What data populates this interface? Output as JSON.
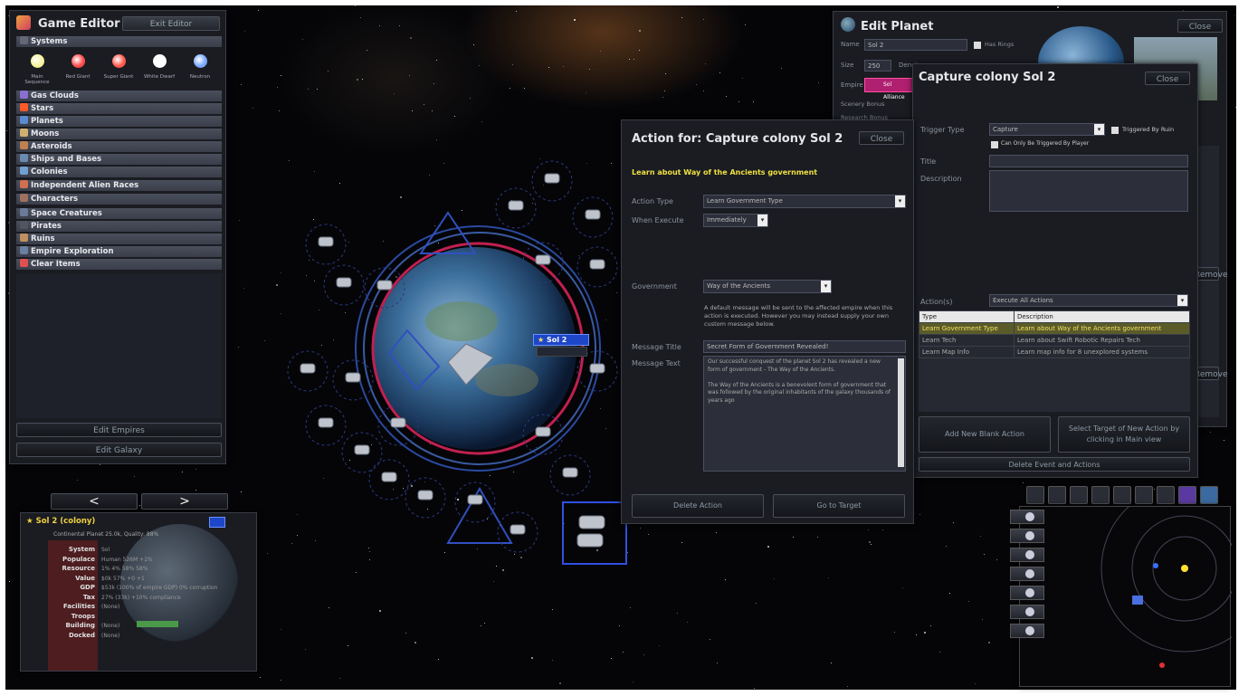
{
  "editor": {
    "title": "Game Editor",
    "exit_label": "Exit Editor",
    "systems_header": "Systems",
    "system_types": [
      {
        "label": "Main Sequence",
        "color": "#f4f29a"
      },
      {
        "label": "Red Giant",
        "color": "#ff4a4a"
      },
      {
        "label": "Super Giant",
        "color": "#ff5a4a"
      },
      {
        "label": "White Dwarf",
        "color": "#ffffff"
      },
      {
        "label": "Neutron",
        "color": "#7aa8ff"
      }
    ],
    "categories": [
      {
        "label": "Gas Clouds",
        "color": "#8a6fd0"
      },
      {
        "label": "Stars",
        "color": "#ff5a2a"
      },
      {
        "label": "Planets",
        "color": "#5a8ad0"
      },
      {
        "label": "Moons",
        "color": "#d0b070"
      },
      {
        "label": "Asteroids",
        "color": "#c08050"
      },
      {
        "label": "Ships and Bases",
        "color": "#6a8ab0"
      },
      {
        "label": "Colonies",
        "color": "#70a0d0"
      },
      {
        "label": "Independent Alien Races",
        "color": "#d07050"
      },
      {
        "label": "Characters",
        "color": "#a07060"
      },
      {
        "label": "Space Creatures",
        "color": "#6a7a9a"
      },
      {
        "label": "Pirates",
        "color": "#505560"
      },
      {
        "label": "Ruins",
        "color": "#c09060"
      },
      {
        "label": "Empire Exploration",
        "color": "#6a80a0"
      },
      {
        "label": "Clear Items",
        "color": "#e05050"
      }
    ],
    "edit_empires": "Edit Empires",
    "edit_galaxy": "Edit Galaxy"
  },
  "colony": {
    "name": "Sol 2 (colony)",
    "subtitle": "Continental Planet 25.0k, Quality: 88%",
    "rows": [
      {
        "label": "System",
        "value": "Sol"
      },
      {
        "label": "Populace",
        "value": "Human    526M  +1%"
      },
      {
        "label": "Resource",
        "value": "1%  4%  58%  58%"
      },
      {
        "label": "Value",
        "value": "$0k  57%  +0  +1"
      },
      {
        "label": "GDP",
        "value": "$53k (100% of empire GDP) 0% corruption"
      },
      {
        "label": "Tax",
        "value": "27% (33k) +10% compliance"
      },
      {
        "label": "Facilities",
        "value": "(None)"
      },
      {
        "label": "Troops",
        "value": ""
      },
      {
        "label": "Building",
        "value": "(None)"
      },
      {
        "label": "Docked",
        "value": "(None)"
      }
    ]
  },
  "planet_label": "Sol 2",
  "action": {
    "title": "Action for: Capture colony Sol 2",
    "close": "Close",
    "subtitle": "Learn about Way of the Ancients government",
    "action_type_label": "Action Type",
    "action_type_value": "Learn Government Type",
    "when_label": "When Execute",
    "when_value": "Immediately",
    "government_label": "Government",
    "government_value": "Way of the Ancients",
    "note": "A default message will be sent to the affected empire when this action is executed. However you may instead supply your own custom message below.",
    "msg_title_label": "Message Title",
    "msg_title_value": "Secret Form of Government Revealed!",
    "msg_text_label": "Message Text",
    "msg_text_value": "Our successful conquest of the planet Sol 2 has revealed a new form of government - The Way of the Ancients.\n\nThe Way of the Ancients is a benevolent form of government that was followed by the original inhabitants of the galaxy thousands of years ago",
    "delete": "Delete Action",
    "goto": "Go to Target"
  },
  "capture": {
    "title": "Capture colony Sol 2",
    "close": "Close",
    "trigger_label": "Trigger Type",
    "trigger_value": "Capture",
    "triggered_by_ruin": "Triggered By Ruin",
    "only_player": "Can Only Be Triggered By Player",
    "title_label": "Title",
    "desc_label": "Description",
    "actions_label": "Action(s)",
    "actions_value": "Execute All Actions",
    "table_headers": [
      "Type",
      "Description"
    ],
    "rows": [
      {
        "type": "Learn Government Type",
        "desc": "Learn about Way of the Ancients government"
      },
      {
        "type": "Learn Tech",
        "desc": "Learn about Swift Robotic Repairs Tech"
      },
      {
        "type": "Learn Map Info",
        "desc": "Learn map info for 8 unexplored systems"
      }
    ],
    "add_blank": "Add New Blank Action",
    "select_target": "Select Target of New Action by clicking in Main view",
    "delete_event": "Delete Event and Actions"
  },
  "editplanet": {
    "title": "Edit Planet",
    "close": "Close",
    "name_label": "Name",
    "name_value": "Sol 2",
    "has_rings": "Has Rings",
    "size_label": "Size",
    "size_value": "250",
    "density_label": "Density",
    "empire_label": "Empire",
    "empire_value": "Sol Alliance",
    "scenery_label": "Scenery Bonus",
    "research_label": "Research Bonus",
    "remove": "Remove"
  },
  "colors": {
    "panel_bg": "#1a1c22",
    "accent_yellow": "#f0e040",
    "selected_row": "#5b5b2a"
  }
}
